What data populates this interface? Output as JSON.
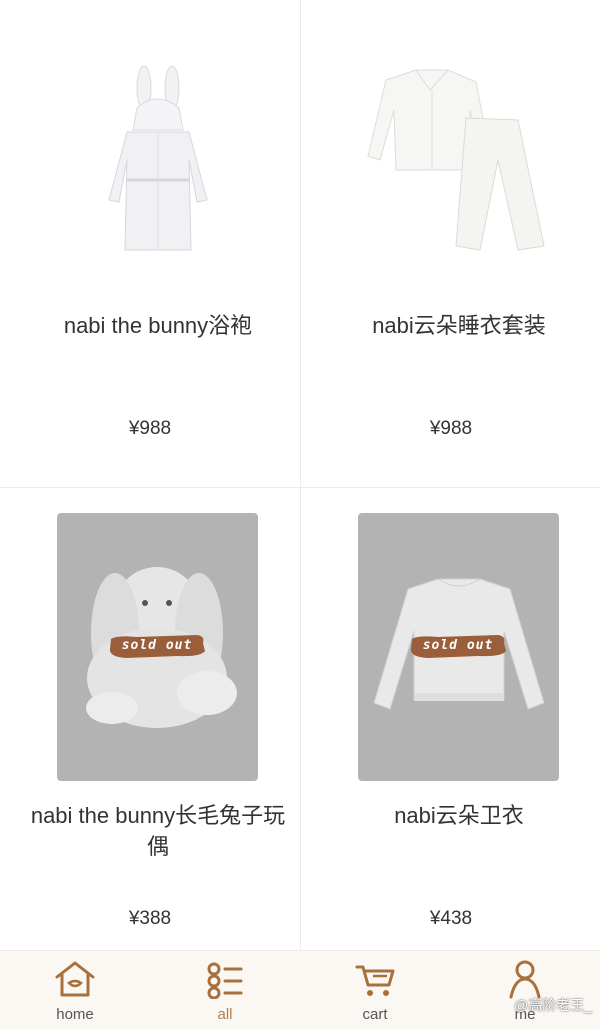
{
  "products": [
    {
      "name": "nabi the bunny浴袍",
      "price": "¥988",
      "sold_out": false,
      "image_icon": "bathrobe-image"
    },
    {
      "name": "nabi云朵睡衣套装",
      "price": "¥988",
      "sold_out": false,
      "image_icon": "pajama-set-image"
    },
    {
      "name": "nabi the bunny长毛兔子玩偶",
      "price": "¥388",
      "sold_out": true,
      "image_icon": "plush-bunny-image"
    },
    {
      "name": "nabi云朵卫衣",
      "price": "¥438",
      "sold_out": true,
      "image_icon": "sweatshirt-image"
    }
  ],
  "sold_out_label": "sold out",
  "tabbar": {
    "items": [
      {
        "label": "home",
        "icon": "home-icon"
      },
      {
        "label": "all",
        "icon": "list-icon",
        "active": true
      },
      {
        "label": "cart",
        "icon": "cart-icon"
      },
      {
        "label": "me",
        "icon": "person-icon"
      }
    ]
  },
  "watermark": "@高阶老王_",
  "colors": {
    "accent": "#b08050",
    "icon_brown": "#a8703c",
    "sold_out_badge": "#9a5f3a",
    "tabbar_bg": "#fbf8f4"
  }
}
